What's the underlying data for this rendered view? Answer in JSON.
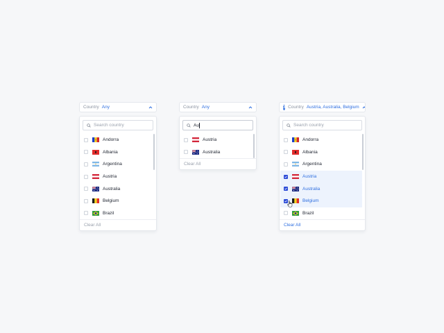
{
  "colors": {
    "accent": "#2f6fe0",
    "checkbox_checked": "#2f4ed8",
    "selected_row_bg": "#edf3fd"
  },
  "widgets": [
    {
      "label": "Country",
      "value": "Any",
      "search_placeholder": "Search country",
      "search_value": "",
      "clear_label": "Clear All",
      "items": [
        {
          "name": "Andorra",
          "flag": "andorra-flag-icon",
          "checked": false
        },
        {
          "name": "Albania",
          "flag": "albania-flag-icon",
          "checked": false
        },
        {
          "name": "Argentina",
          "flag": "argentina-flag-icon",
          "checked": false
        },
        {
          "name": "Austria",
          "flag": "austria-flag-icon",
          "checked": false
        },
        {
          "name": "Australia",
          "flag": "australia-flag-icon",
          "checked": false
        },
        {
          "name": "Belgium",
          "flag": "belgium-flag-icon",
          "checked": false
        },
        {
          "name": "Brazil",
          "flag": "brazil-flag-icon",
          "checked": false
        }
      ]
    },
    {
      "label": "Country",
      "value": "Any",
      "search_placeholder": "Search country",
      "search_value": "Au",
      "clear_label": "Clear All",
      "items": [
        {
          "name": "Austria",
          "flag": "austria-flag-icon",
          "checked": false
        },
        {
          "name": "Australia",
          "flag": "australia-flag-icon",
          "checked": false
        }
      ]
    },
    {
      "badge_count": "3",
      "label": "Country",
      "value": "Austria, Australia, Belgium",
      "search_placeholder": "Search country",
      "search_value": "",
      "clear_label": "Clear All",
      "items": [
        {
          "name": "Andorra",
          "flag": "andorra-flag-icon",
          "checked": false
        },
        {
          "name": "Albania",
          "flag": "albania-flag-icon",
          "checked": false
        },
        {
          "name": "Argentina",
          "flag": "argentina-flag-icon",
          "checked": false
        },
        {
          "name": "Austria",
          "flag": "austria-flag-icon",
          "checked": true
        },
        {
          "name": "Australia",
          "flag": "australia-flag-icon",
          "checked": true
        },
        {
          "name": "Belgium",
          "flag": "belgium-flag-icon",
          "checked": true
        },
        {
          "name": "Brazil",
          "flag": "brazil-flag-icon",
          "checked": false
        }
      ]
    }
  ]
}
